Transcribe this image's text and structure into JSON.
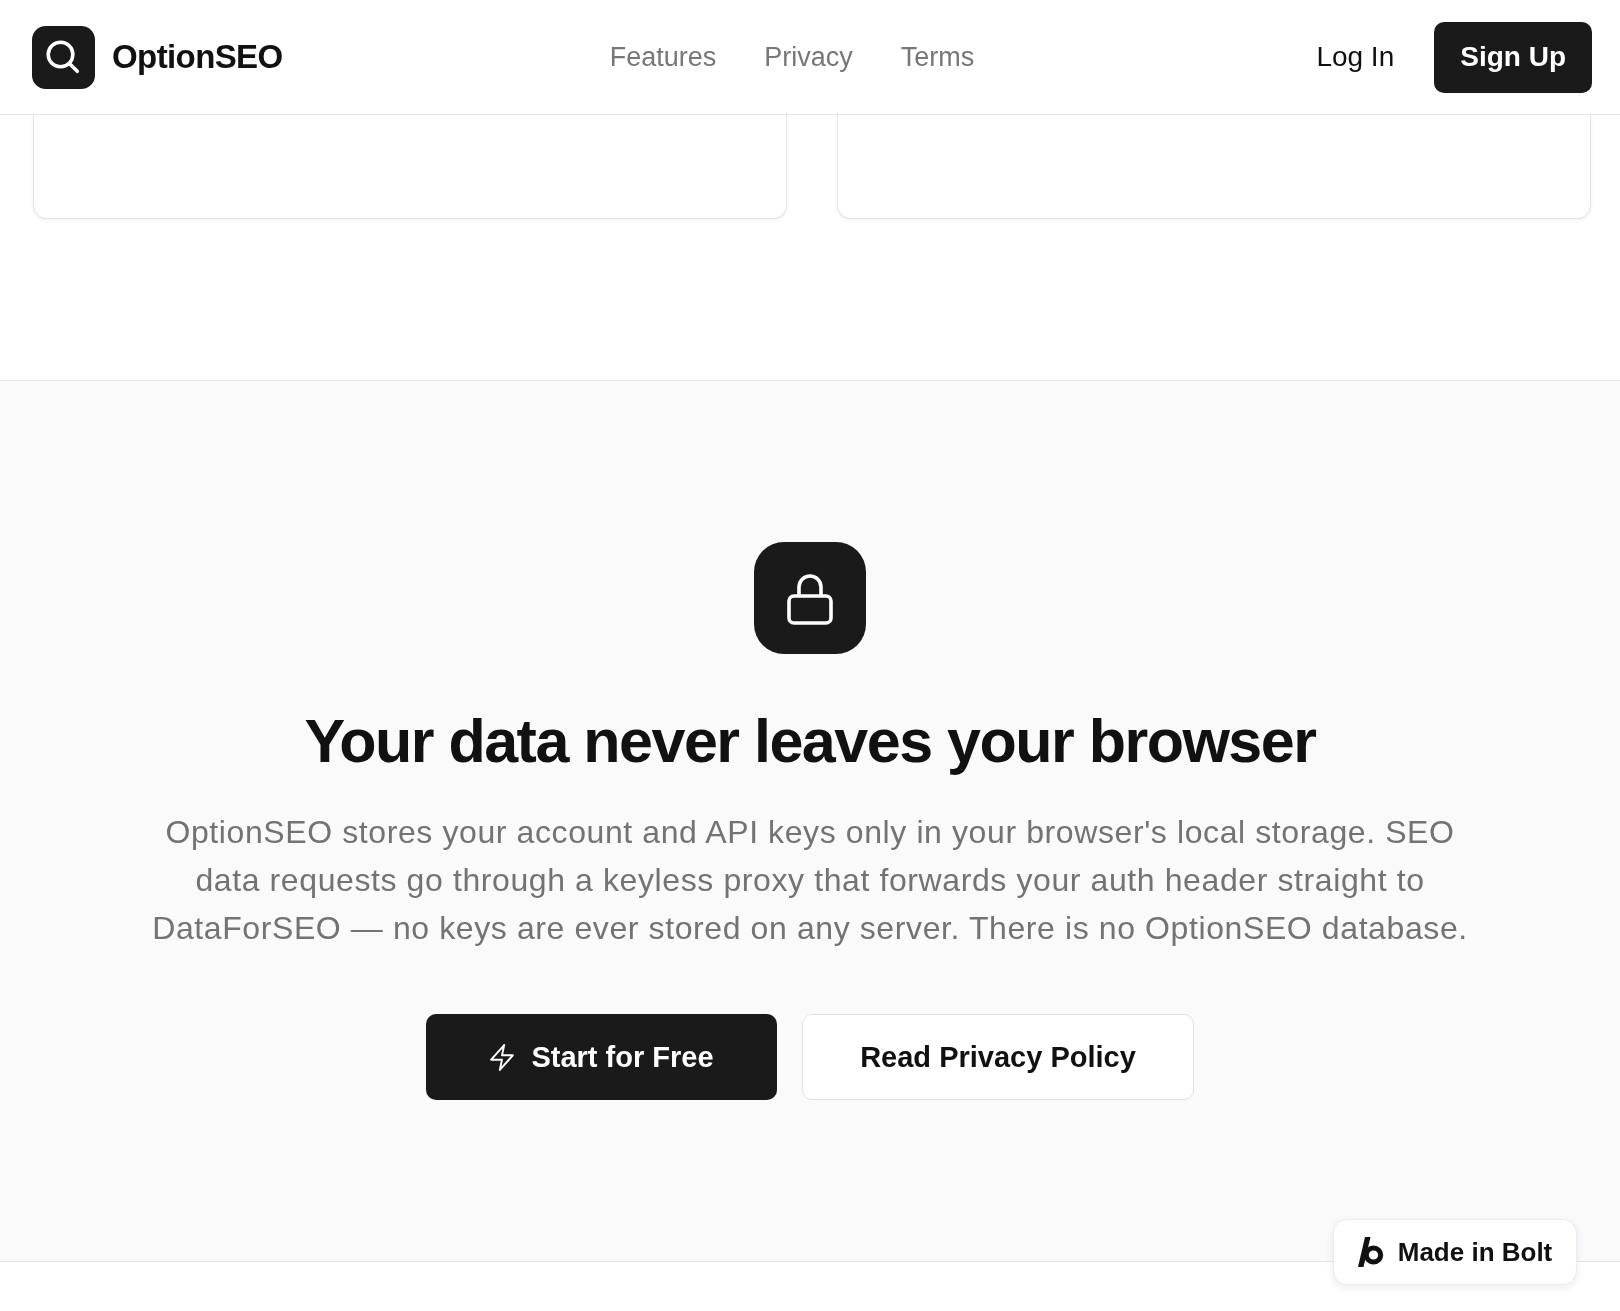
{
  "header": {
    "logo": "OptionSEO",
    "nav": [
      {
        "label": "Features"
      },
      {
        "label": "Privacy"
      },
      {
        "label": "Terms"
      }
    ],
    "login": "Log In",
    "signup": "Sign Up"
  },
  "privacy": {
    "heading": "Your data never leaves your browser",
    "body": "OptionSEO stores your account and API keys only in your browser's local storage. SEO data requests go through a keyless proxy that forwards your auth header straight to DataForSEO — no keys are ever stored on any server. There is no OptionSEO database.",
    "buttons": [
      {
        "label": "Start for Free",
        "kind": "primary"
      },
      {
        "label": "Read Privacy Policy",
        "kind": "secondary"
      }
    ]
  },
  "badge": {
    "label": "Made in Bolt"
  }
}
